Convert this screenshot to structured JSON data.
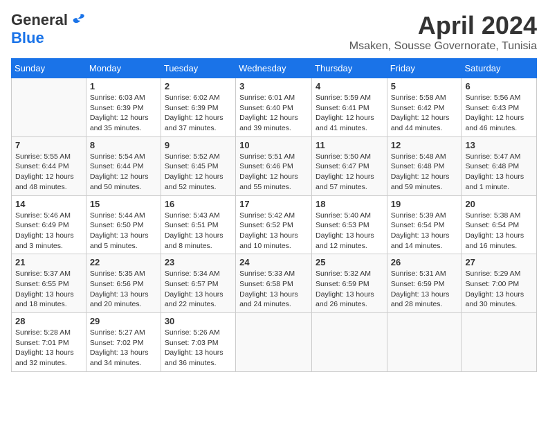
{
  "header": {
    "logo_general": "General",
    "logo_blue": "Blue",
    "title": "April 2024",
    "location": "Msaken, Sousse Governorate, Tunisia"
  },
  "weekdays": [
    "Sunday",
    "Monday",
    "Tuesday",
    "Wednesday",
    "Thursday",
    "Friday",
    "Saturday"
  ],
  "weeks": [
    [
      {
        "day": "",
        "info": ""
      },
      {
        "day": "1",
        "info": "Sunrise: 6:03 AM\nSunset: 6:39 PM\nDaylight: 12 hours\nand 35 minutes."
      },
      {
        "day": "2",
        "info": "Sunrise: 6:02 AM\nSunset: 6:39 PM\nDaylight: 12 hours\nand 37 minutes."
      },
      {
        "day": "3",
        "info": "Sunrise: 6:01 AM\nSunset: 6:40 PM\nDaylight: 12 hours\nand 39 minutes."
      },
      {
        "day": "4",
        "info": "Sunrise: 5:59 AM\nSunset: 6:41 PM\nDaylight: 12 hours\nand 41 minutes."
      },
      {
        "day": "5",
        "info": "Sunrise: 5:58 AM\nSunset: 6:42 PM\nDaylight: 12 hours\nand 44 minutes."
      },
      {
        "day": "6",
        "info": "Sunrise: 5:56 AM\nSunset: 6:43 PM\nDaylight: 12 hours\nand 46 minutes."
      }
    ],
    [
      {
        "day": "7",
        "info": "Sunrise: 5:55 AM\nSunset: 6:44 PM\nDaylight: 12 hours\nand 48 minutes."
      },
      {
        "day": "8",
        "info": "Sunrise: 5:54 AM\nSunset: 6:44 PM\nDaylight: 12 hours\nand 50 minutes."
      },
      {
        "day": "9",
        "info": "Sunrise: 5:52 AM\nSunset: 6:45 PM\nDaylight: 12 hours\nand 52 minutes."
      },
      {
        "day": "10",
        "info": "Sunrise: 5:51 AM\nSunset: 6:46 PM\nDaylight: 12 hours\nand 55 minutes."
      },
      {
        "day": "11",
        "info": "Sunrise: 5:50 AM\nSunset: 6:47 PM\nDaylight: 12 hours\nand 57 minutes."
      },
      {
        "day": "12",
        "info": "Sunrise: 5:48 AM\nSunset: 6:48 PM\nDaylight: 12 hours\nand 59 minutes."
      },
      {
        "day": "13",
        "info": "Sunrise: 5:47 AM\nSunset: 6:48 PM\nDaylight: 13 hours\nand 1 minute."
      }
    ],
    [
      {
        "day": "14",
        "info": "Sunrise: 5:46 AM\nSunset: 6:49 PM\nDaylight: 13 hours\nand 3 minutes."
      },
      {
        "day": "15",
        "info": "Sunrise: 5:44 AM\nSunset: 6:50 PM\nDaylight: 13 hours\nand 5 minutes."
      },
      {
        "day": "16",
        "info": "Sunrise: 5:43 AM\nSunset: 6:51 PM\nDaylight: 13 hours\nand 8 minutes."
      },
      {
        "day": "17",
        "info": "Sunrise: 5:42 AM\nSunset: 6:52 PM\nDaylight: 13 hours\nand 10 minutes."
      },
      {
        "day": "18",
        "info": "Sunrise: 5:40 AM\nSunset: 6:53 PM\nDaylight: 13 hours\nand 12 minutes."
      },
      {
        "day": "19",
        "info": "Sunrise: 5:39 AM\nSunset: 6:54 PM\nDaylight: 13 hours\nand 14 minutes."
      },
      {
        "day": "20",
        "info": "Sunrise: 5:38 AM\nSunset: 6:54 PM\nDaylight: 13 hours\nand 16 minutes."
      }
    ],
    [
      {
        "day": "21",
        "info": "Sunrise: 5:37 AM\nSunset: 6:55 PM\nDaylight: 13 hours\nand 18 minutes."
      },
      {
        "day": "22",
        "info": "Sunrise: 5:35 AM\nSunset: 6:56 PM\nDaylight: 13 hours\nand 20 minutes."
      },
      {
        "day": "23",
        "info": "Sunrise: 5:34 AM\nSunset: 6:57 PM\nDaylight: 13 hours\nand 22 minutes."
      },
      {
        "day": "24",
        "info": "Sunrise: 5:33 AM\nSunset: 6:58 PM\nDaylight: 13 hours\nand 24 minutes."
      },
      {
        "day": "25",
        "info": "Sunrise: 5:32 AM\nSunset: 6:59 PM\nDaylight: 13 hours\nand 26 minutes."
      },
      {
        "day": "26",
        "info": "Sunrise: 5:31 AM\nSunset: 6:59 PM\nDaylight: 13 hours\nand 28 minutes."
      },
      {
        "day": "27",
        "info": "Sunrise: 5:29 AM\nSunset: 7:00 PM\nDaylight: 13 hours\nand 30 minutes."
      }
    ],
    [
      {
        "day": "28",
        "info": "Sunrise: 5:28 AM\nSunset: 7:01 PM\nDaylight: 13 hours\nand 32 minutes."
      },
      {
        "day": "29",
        "info": "Sunrise: 5:27 AM\nSunset: 7:02 PM\nDaylight: 13 hours\nand 34 minutes."
      },
      {
        "day": "30",
        "info": "Sunrise: 5:26 AM\nSunset: 7:03 PM\nDaylight: 13 hours\nand 36 minutes."
      },
      {
        "day": "",
        "info": ""
      },
      {
        "day": "",
        "info": ""
      },
      {
        "day": "",
        "info": ""
      },
      {
        "day": "",
        "info": ""
      }
    ]
  ]
}
